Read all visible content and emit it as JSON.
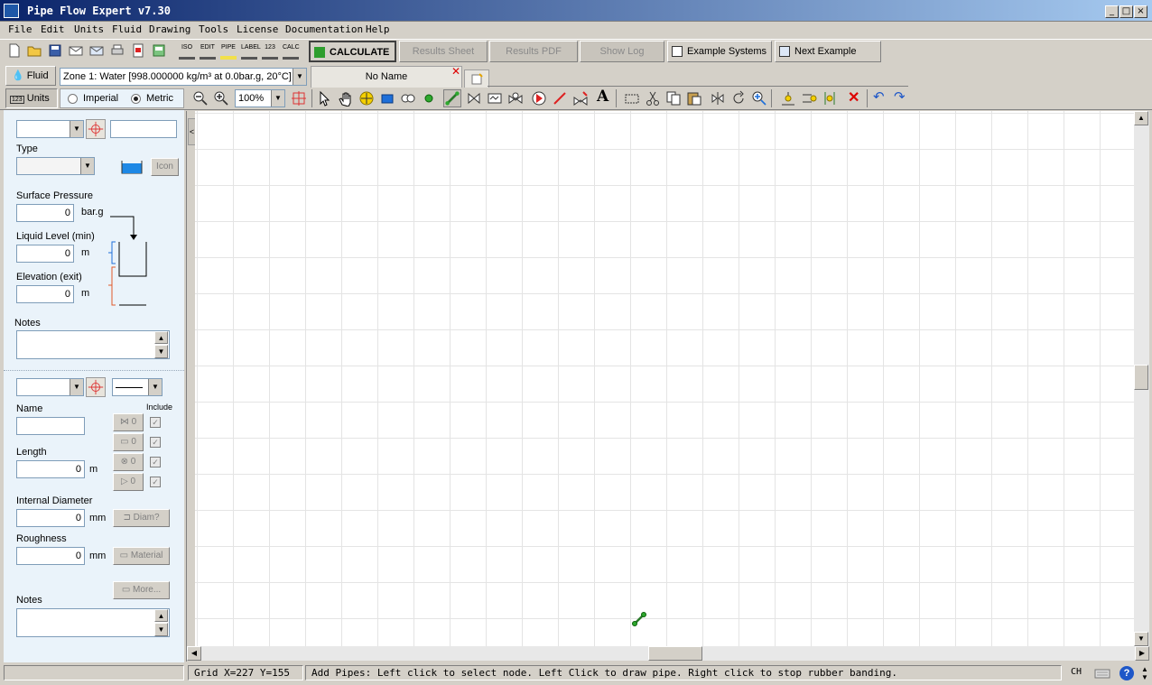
{
  "window": {
    "title": "Pipe Flow Expert v7.30"
  },
  "menu": [
    "File",
    "Edit",
    "Units",
    "Fluid",
    "Drawing",
    "Tools",
    "License",
    "Documentation",
    "Help"
  ],
  "toolbar1": {
    "small_icons": [
      "ISO",
      "EDIT",
      "PIPE",
      "LABEL",
      "123",
      "CALC"
    ],
    "calculate": "CALCULATE",
    "results_sheet": "Results Sheet",
    "results_pdf": "Results PDF",
    "show_log": "Show Log",
    "example_systems": "Example Systems",
    "next_example": "Next Example"
  },
  "fluid": {
    "button": "Fluid",
    "zone": "Zone 1: Water [998.000000 kg/m³ at 0.0bar.g, 20°C]"
  },
  "tabs": {
    "active": "No Name"
  },
  "units": {
    "button": "Units",
    "imperial": "Imperial",
    "metric": "Metric",
    "selected": "Metric"
  },
  "zoom": {
    "value": "100%"
  },
  "tank_panel": {
    "type_label": "Type",
    "icon_button": "Icon",
    "surface_pressure_label": "Surface Pressure",
    "surface_pressure_value": "0",
    "surface_pressure_unit": "bar.g",
    "liquid_level_label": "Liquid Level (min)",
    "liquid_level_value": "0",
    "liquid_level_unit": "m",
    "elevation_label": "Elevation (exit)",
    "elevation_value": "0",
    "elevation_unit": "m",
    "notes_label": "Notes"
  },
  "pipe_panel": {
    "include_label": "Include",
    "name_label": "Name",
    "length_label": "Length",
    "length_value": "0",
    "length_unit": "m",
    "fitting_counts": [
      "0",
      "0",
      "0",
      "0"
    ],
    "internal_diameter_label": "Internal Diameter",
    "internal_diameter_value": "0",
    "internal_diameter_unit": "mm",
    "diam_button": "Diam?",
    "roughness_label": "Roughness",
    "roughness_value": "0",
    "roughness_unit": "mm",
    "material_button": "Material",
    "more_button": "More...",
    "notes_label": "Notes"
  },
  "status": {
    "grid": "Grid  X=227  Y=155",
    "message": "Add Pipes: Left click to select node. Left Click to draw pipe. Right click to stop rubber banding.",
    "lang": "CH"
  },
  "colors": {
    "titlebar": "#0a246a",
    "panel": "#eaf3fa",
    "tank": "#1e88e5",
    "accent_green": "#2e9e2e"
  }
}
